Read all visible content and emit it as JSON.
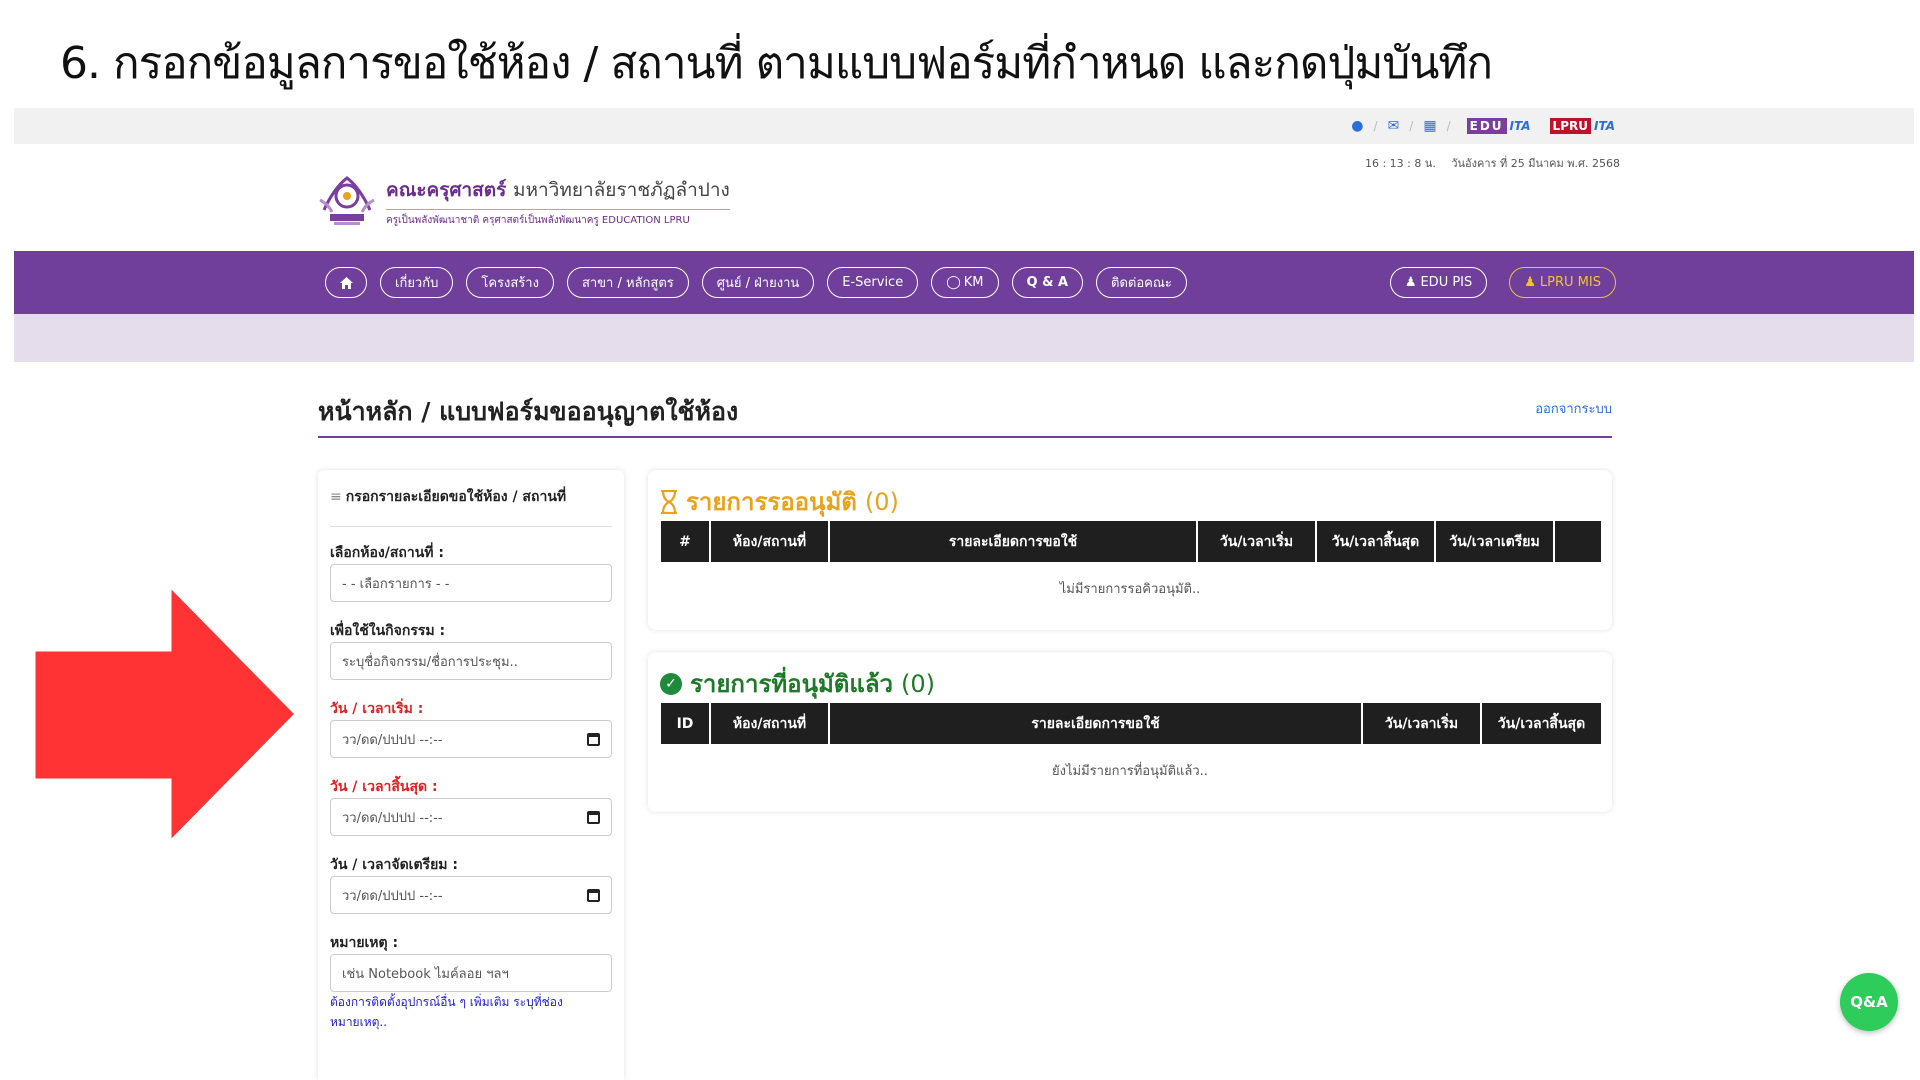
{
  "slide": {
    "title": "6. กรอกข้อมูลการขอใช้ห้อง / สถานที่ ตามแบบฟอร์มที่กำหนด และกดปุ่มบันทึก"
  },
  "topbar": {
    "icons": [
      "facebook-icon",
      "mail-icon",
      "sitemap-icon"
    ],
    "sep": "/",
    "badges": {
      "edu": "EDU",
      "ita1": "ITA",
      "lpru": "LPRU",
      "ita2": "ITA"
    }
  },
  "datetime": {
    "time": "16 : 13 : 8 น.",
    "date": "วันอังคาร ที่ 25 มีนาคม พ.ศ. 2568"
  },
  "logo": {
    "name": "คณะครุศาสตร์",
    "university": "มหาวิทยาลัยราชภัฏลำปาง",
    "tagline": "ครูเป็นพลังพัฒนาชาติ ครุศาสตร์เป็นพลังพัฒนาครู EDUCATION LPRU"
  },
  "nav": {
    "items": [
      {
        "label": "เกี่ยวกับ"
      },
      {
        "label": "โครงสร้าง"
      },
      {
        "label": "สาขา / หลักสูตร"
      },
      {
        "label": "ศูนย์ / ฝ่ายงาน"
      },
      {
        "label": "E-Service"
      },
      {
        "label": "KM"
      },
      {
        "label": "Q & A"
      },
      {
        "label": "ติดต่อคณะ"
      }
    ],
    "edu_pis": "EDU PIS",
    "lpru_mis": "LPRU MIS"
  },
  "page": {
    "heading": "หน้าหลัก / แบบฟอร์มขออนุญาตใช้ห้อง",
    "logout": "ออกจากระบบ"
  },
  "form": {
    "header": "กรอกรายละเอียดขอใช้ห้อง / สถานที่",
    "room_label": "เลือกห้อง/สถานที่ :",
    "room_value": "- - เลือกรายการ - -",
    "activity_label": "เพื่อใช้ในกิจกรรม :",
    "activity_placeholder": "ระบุชื่อกิจกรรม/ชื่อการประชุม..",
    "start_label": "วัน / เวลาเริ่ม :",
    "end_label": "วัน / เวลาสิ้นสุด :",
    "prep_label": "วัน / เวลาจัดเตรียม :",
    "datetime_placeholder": "วว/ดด/ปปปป --:--",
    "note_label": "หมายเหตุ :",
    "note_placeholder": "เช่น Notebook ไมค์ลอย ฯลฯ",
    "note_hint": "ต้องการติดตั้งอุปกรณ์อื่น ๆ เพิ่มเติม ระบุที่ช่องหมายเหตุ.."
  },
  "pending": {
    "title": "รายการรออนุมัติ",
    "count": "(0)",
    "columns": [
      "#",
      "ห้อง/สถานที่",
      "รายละเอียดการขอใช้",
      "วัน/เวลาเริ่ม",
      "วัน/เวลาสิ้นสุด",
      "วัน/เวลาเตรียม",
      ""
    ],
    "empty": "ไม่มีรายการรอคิวอนุมัติ.."
  },
  "approved": {
    "title": "รายการที่อนุมัติแล้ว",
    "count": "(0)",
    "columns": [
      "ID",
      "ห้อง/สถานที่",
      "รายละเอียดการขอใช้",
      "วัน/เวลาเริ่ม",
      "วัน/เวลาสิ้นสุด"
    ],
    "empty": "ยังไม่มีรายการที่อนุมัติแล้ว.."
  },
  "fab": {
    "label": "Q&A"
  },
  "colors": {
    "purple": "#6f3f9b",
    "arrow": "#ff3333",
    "pending": "#e8a21c",
    "approved": "#1e7a28",
    "mis": "#f1c232"
  }
}
